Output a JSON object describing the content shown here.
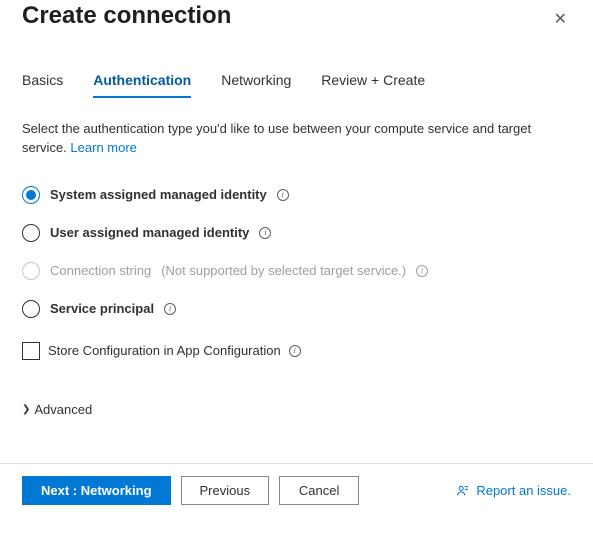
{
  "header": {
    "title": "Create connection"
  },
  "tabs": [
    {
      "label": "Basics"
    },
    {
      "label": "Authentication",
      "active": true
    },
    {
      "label": "Networking"
    },
    {
      "label": "Review + Create"
    }
  ],
  "description": {
    "text": "Select the authentication type you'd like to use between your compute service and target service.",
    "learn_more": "Learn more"
  },
  "auth_options": {
    "system_identity": "System assigned managed identity",
    "user_identity": "User assigned managed identity",
    "conn_string": "Connection string",
    "conn_string_hint": "(Not supported by selected target service.)",
    "service_principal": "Service principal"
  },
  "store_config": {
    "label": "Store Configuration in App Configuration"
  },
  "advanced": {
    "label": "Advanced"
  },
  "footer": {
    "next": "Next : Networking",
    "previous": "Previous",
    "cancel": "Cancel",
    "report": "Report an issue."
  }
}
